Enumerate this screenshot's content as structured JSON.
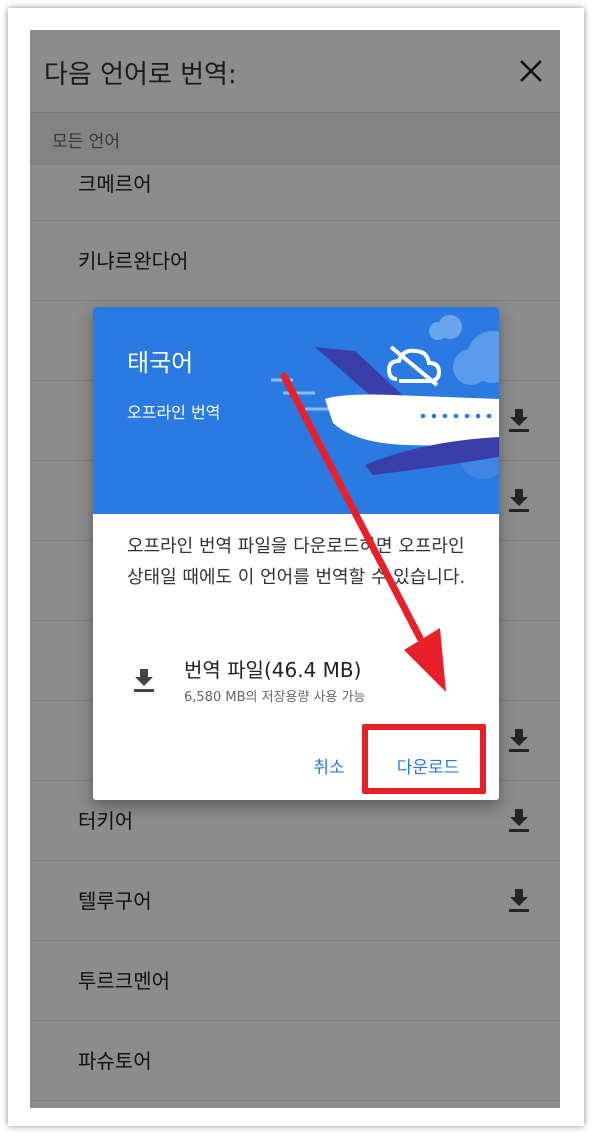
{
  "header": {
    "title": "다음 언어로 번역:",
    "close_icon": "close-icon"
  },
  "section": {
    "label": "모든 언어"
  },
  "languages": [
    {
      "label": "크메르어",
      "downloadable": false
    },
    {
      "label": "키냐르완다어",
      "downloadable": false
    },
    {
      "label": "",
      "downloadable": false
    },
    {
      "label": "",
      "downloadable": true
    },
    {
      "label": "",
      "downloadable": true
    },
    {
      "label": "",
      "downloadable": false
    },
    {
      "label": "",
      "downloadable": false
    },
    {
      "label": "",
      "downloadable": true
    },
    {
      "label": "터키어",
      "downloadable": true
    },
    {
      "label": "텔루구어",
      "downloadable": true
    },
    {
      "label": "투르크멘어",
      "downloadable": false
    },
    {
      "label": "파슈토어",
      "downloadable": false
    }
  ],
  "dialog": {
    "title": "태국어",
    "subtitle": "오프라인 번역",
    "description": "오프라인 번역 파일을 다운로드하면 오프라인 상태일 때에도 이 언어를 번역할 수 있습니다.",
    "file_name": "번역 파일(46.4 MB)",
    "file_storage": "6,580 MB의 저장용량 사용 가능",
    "cancel_label": "취소",
    "download_label": "다운로드"
  },
  "colors": {
    "accent": "#2a7ae2",
    "annotation": "#e8202a"
  }
}
